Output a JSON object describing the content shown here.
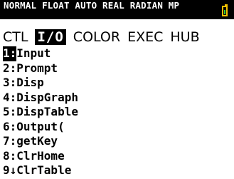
{
  "status_bar": {
    "text": "NORMAL FLOAT AUTO REAL RADIAN MP",
    "battery_color": "#f2c100",
    "battery_level": 0.5
  },
  "tabs": [
    {
      "label": "CTL",
      "selected": false
    },
    {
      "label": "I/O",
      "selected": true
    },
    {
      "label": "COLOR",
      "selected": false
    },
    {
      "label": "EXEC",
      "selected": false
    },
    {
      "label": "HUB",
      "selected": false
    }
  ],
  "menu": [
    {
      "num": "1:",
      "label": "Input",
      "selected": true
    },
    {
      "num": "2:",
      "label": "Prompt",
      "selected": false
    },
    {
      "num": "3:",
      "label": "Disp",
      "selected": false
    },
    {
      "num": "4:",
      "label": "DispGraph",
      "selected": false
    },
    {
      "num": "5:",
      "label": "DispTable",
      "selected": false
    },
    {
      "num": "6:",
      "label": "Output(",
      "selected": false
    },
    {
      "num": "7:",
      "label": "getKey",
      "selected": false
    },
    {
      "num": "8:",
      "label": "ClrHome",
      "selected": false
    },
    {
      "num": "9↓",
      "label": "ClrTable",
      "selected": false
    }
  ]
}
